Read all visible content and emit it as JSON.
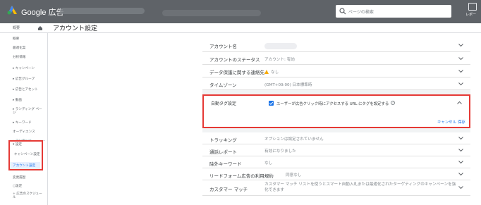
{
  "header": {
    "brand": "Google 広告",
    "search_placeholder": "ページの検索",
    "report_label": "レポー"
  },
  "breadcrumb": {
    "all_label": "概要"
  },
  "page_title": "アカウント設定",
  "sidebar": {
    "items": [
      {
        "label": "概要"
      },
      {
        "label": "最適化案"
      },
      {
        "label": "分析情報"
      },
      {
        "label": "▸ キャンペーン"
      },
      {
        "label": "▸ 広告グループ"
      },
      {
        "label": "▸ 広告とアセット"
      },
      {
        "label": "▸ 動画"
      },
      {
        "label": "▸ ランディング ページ"
      },
      {
        "label": "▸ キーワード"
      },
      {
        "label": "オーディエンス"
      },
      {
        "label": "▸ コンテンツ"
      },
      {
        "label": "▾ 設定"
      },
      {
        "label": "キャンペーン設定"
      },
      {
        "label": "アカウント設定"
      },
      {
        "label": "変更履歴"
      },
      {
        "label": "広告のスケジュール"
      }
    ],
    "extra_top": "○設定",
    "extra_bottom": "+ 広告のスケジュール"
  },
  "settings": {
    "rows_top": [
      {
        "label": "アカウント名",
        "value": ""
      },
      {
        "label": "アカウントのステータス",
        "value": "アカウント: 有効"
      },
      {
        "label": "データ保護に関する連絡先",
        "value": "なし"
      },
      {
        "label": "タイムゾーン",
        "value": "(GMT+09:00) 日本標準時"
      }
    ],
    "expanded": {
      "label": "自動タグ設定",
      "checkbox_text": "ユーザーが広告クリック時にアクセスする URL にタグを設定する",
      "cancel": "キャンセル",
      "save": "保存"
    },
    "rows_bottom": [
      {
        "label": "トラッキング",
        "value": "オプションは設定されていません"
      },
      {
        "label": "通話レポート",
        "value": "有効になりました"
      },
      {
        "label": "除外キーワード",
        "value": "なし"
      },
      {
        "label": "リードフォーム広告の利用規約",
        "value": "同意なし"
      },
      {
        "label": "カスタマー マッチ",
        "value": "カスタマー マッチ リストを使うとスマート自動入札または最適化されたターゲティングのキャンペーンを強化できます"
      }
    ]
  },
  "colors": {
    "topbar": "#5f6368",
    "accent": "#1a73e8",
    "highlight": "#e53935"
  }
}
